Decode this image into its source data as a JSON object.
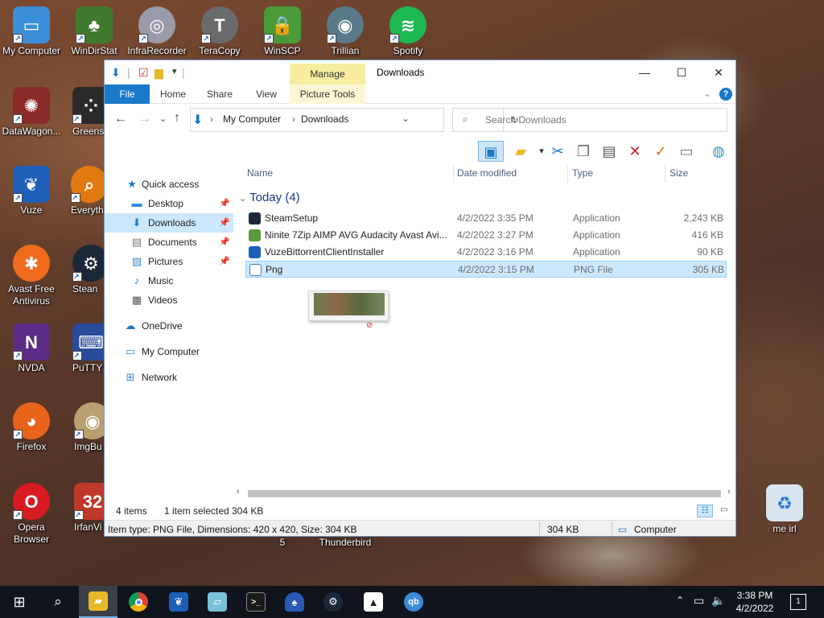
{
  "desktop": {
    "icons": [
      {
        "label": "My Computer"
      },
      {
        "label": "WinDirStat"
      },
      {
        "label": "InfraRecorder"
      },
      {
        "label": "TeraCopy"
      },
      {
        "label": "WinSCP"
      },
      {
        "label": "Trillian"
      },
      {
        "label": "Spotify"
      },
      {
        "label": "DataWagon..."
      },
      {
        "label": "Greensh"
      },
      {
        "label": "Vuze"
      },
      {
        "label": "Everyth"
      },
      {
        "label": "Avast Free Antivirus"
      },
      {
        "label": "Stean"
      },
      {
        "label": "NVDA"
      },
      {
        "label": "PuTTY"
      },
      {
        "label": "Firefox"
      },
      {
        "label": "ImgBu"
      },
      {
        "label": "Opera Browser"
      },
      {
        "label": "IrfanVi"
      },
      {
        "label": "me irl"
      }
    ],
    "partial_labels": {
      "five": "5",
      "thunderbird": "Thunderbird"
    }
  },
  "explorer": {
    "title": "Downloads",
    "ribbon": {
      "tabs": [
        "File",
        "Home",
        "Share",
        "View"
      ],
      "context_group": "Manage",
      "context_tab": "Picture Tools"
    },
    "address": {
      "crumbs": [
        "My Computer",
        "Downloads"
      ],
      "search_placeholder": "Search Downloads"
    },
    "nav": {
      "quick_access": "Quick access",
      "pinned": [
        "Desktop",
        "Downloads",
        "Documents",
        "Pictures"
      ],
      "items": [
        "Music",
        "Videos"
      ],
      "onedrive": "OneDrive",
      "my_computer": "My Computer",
      "network": "Network"
    },
    "columns": {
      "name": "Name",
      "date": "Date modified",
      "type": "Type",
      "size": "Size"
    },
    "group_header": "Today (4)",
    "files": [
      {
        "name": "SteamSetup",
        "date": "4/2/2022 3:35 PM",
        "type": "Application",
        "size": "2,243 KB",
        "icon": "steam-icon"
      },
      {
        "name": "Ninite 7Zip AIMP AVG Audacity Avast Avi...",
        "date": "4/2/2022 3:27 PM",
        "type": "Application",
        "size": "416 KB",
        "icon": "ninite-icon"
      },
      {
        "name": "VuzeBittorrentClientInstaller",
        "date": "4/2/2022 3:16 PM",
        "type": "Application",
        "size": "90 KB",
        "icon": "vuze-icon"
      },
      {
        "name": "Png",
        "date": "4/2/2022 3:15 PM",
        "type": "PNG File",
        "size": "305 KB",
        "icon": "image-file-icon"
      }
    ],
    "status": {
      "items": "4 items",
      "selected": "1 item selected",
      "selected_size": "304 KB"
    },
    "details": {
      "text": "Item type: PNG File, Dimensions: 420 x 420, Size: 304 KB",
      "size": "304 KB",
      "location": "Computer"
    }
  },
  "taskbar": {
    "apps": [
      "start-icon",
      "search-icon",
      "file-explorer-icon",
      "chrome-icon",
      "vuze-icon",
      "notepad-icon",
      "terminal-icon",
      "blue-app-icon",
      "steam-icon",
      "photos-icon",
      "qbittorrent-icon"
    ],
    "time": "3:38 PM",
    "date": "4/2/2022",
    "notification_count": "1"
  },
  "colors": {
    "accent": "#1979ca",
    "selection": "#cce8ff",
    "taskbar": "#10141c"
  }
}
